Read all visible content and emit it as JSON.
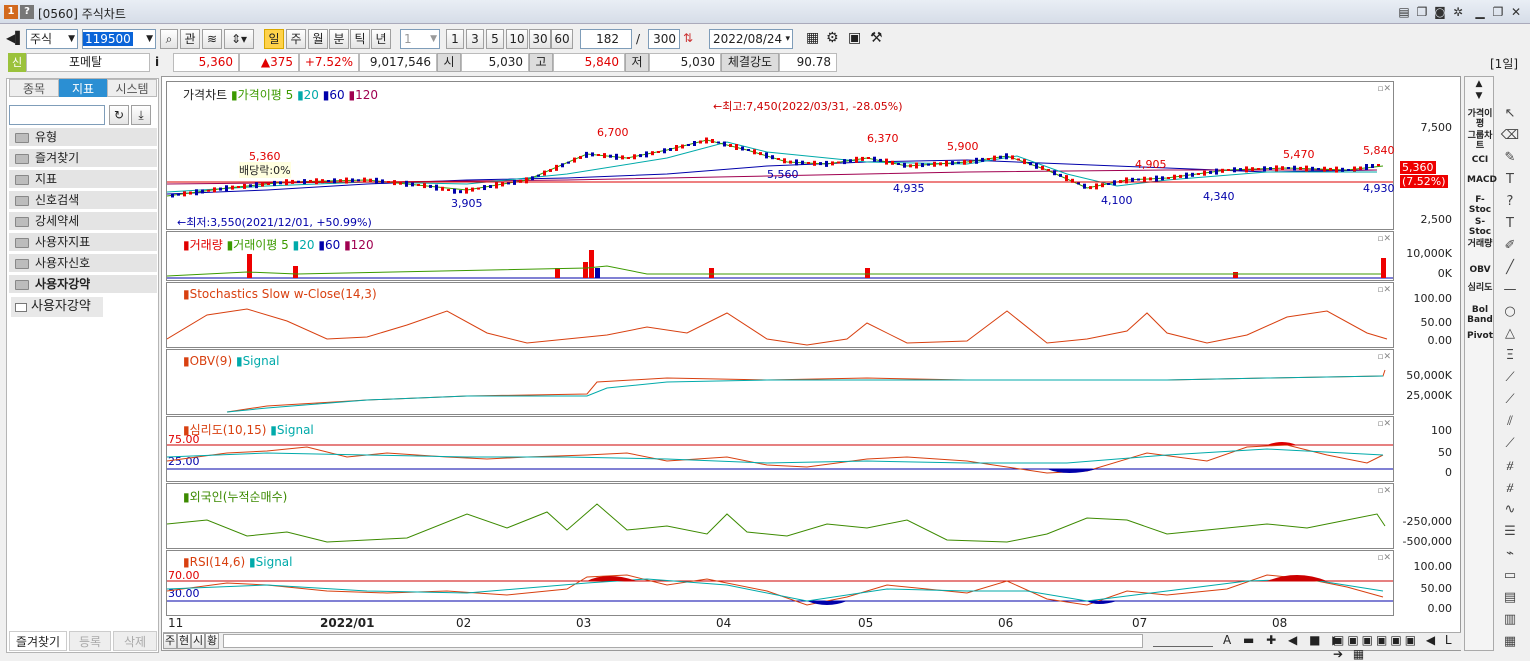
{
  "window": {
    "icon_1": "1",
    "icon_2": "?",
    "title": "[0560] 주식차트"
  },
  "toolbar": {
    "market": "주식",
    "code": "119500",
    "label_gwan": "관",
    "periods": [
      "일",
      "주",
      "월",
      "분",
      "틱",
      "년"
    ],
    "unit_value": "1",
    "quick_units": [
      "1",
      "3",
      "5",
      "10",
      "30",
      "60"
    ],
    "count": "182",
    "slash": "/",
    "total": "300",
    "date": "2022/08/24"
  },
  "quote": {
    "tag": "신",
    "name": "포메탈",
    "info_icon": "i",
    "price": "5,360",
    "change": "▲375",
    "rate": "+7.52%",
    "volume": "9,017,546",
    "open_label": "시",
    "open": "5,030",
    "high_label": "고",
    "high": "5,840",
    "low_label": "저",
    "low": "5,030",
    "strength_label": "체결강도",
    "strength": "90.78",
    "period_badge": "[1일]"
  },
  "left": {
    "tabs": [
      "종목",
      "지표",
      "시스템"
    ],
    "folders": [
      "유형",
      "즐겨찾기",
      "지표",
      "신호검색",
      "강세약세",
      "사용자지표",
      "사용자신호",
      "사용자강약"
    ],
    "open_item": "사용자강약",
    "bottom_buttons": [
      "즐겨찾기",
      "등록",
      "삭제"
    ]
  },
  "panes": {
    "price": {
      "legend": [
        "가격차트",
        "가격이평 5",
        "20",
        "60",
        "120"
      ],
      "max_note": "←최고:7,450(2022/03/31, -28.05%)",
      "min_note": "←최저:3,550(2021/12/01, +50.99%)",
      "dividend": "배당락:0%",
      "labels": [
        "5,360",
        "6,700",
        "3,905",
        "6,370",
        "5,560",
        "5,900",
        "4,935",
        "4,905",
        "4,100",
        "5,470",
        "4,340",
        "5,840",
        "4,930"
      ],
      "y": [
        "7,500",
        "2,500"
      ],
      "last": "5,360",
      "last_rate": "(7.52%)"
    },
    "volume": {
      "legend": [
        "거래량",
        "거래이평 5",
        "20",
        "60",
        "120"
      ],
      "y": [
        "10,000K",
        "0K"
      ]
    },
    "stoch": {
      "legend": [
        "Stochastics Slow w-Close(14,3)"
      ],
      "y": [
        "100.00",
        "50.00",
        "0.00"
      ]
    },
    "obv": {
      "legend": [
        "OBV(9)",
        "Signal"
      ],
      "y": [
        "50,000K",
        "25,000K"
      ]
    },
    "psy": {
      "legend": [
        "심리도(10,15)",
        "Signal"
      ],
      "levels": [
        "75.00",
        "25.00"
      ],
      "y": [
        "100",
        "50",
        "0"
      ]
    },
    "foreign": {
      "legend": [
        "외국인(누적순매수)"
      ],
      "y": [
        "-250,000",
        "-500,000"
      ]
    },
    "rsi": {
      "legend": [
        "RSI(14,6)",
        "Signal"
      ],
      "levels": [
        "70.00",
        "30.00"
      ],
      "y": [
        "100.00",
        "50.00",
        "0.00"
      ]
    }
  },
  "xaxis": [
    "11",
    "2022/01",
    "02",
    "03",
    "04",
    "05",
    "06",
    "07",
    "08"
  ],
  "bottom_tabs": [
    "주",
    "현",
    "시",
    "황"
  ],
  "right_tabs": [
    "가격이평",
    "그룹차트",
    "CCI",
    "MACD",
    "F-Stoc",
    "S-Stoc",
    "거래량",
    "OBV",
    "심리도",
    "Bol Band",
    "Pivot"
  ]
}
